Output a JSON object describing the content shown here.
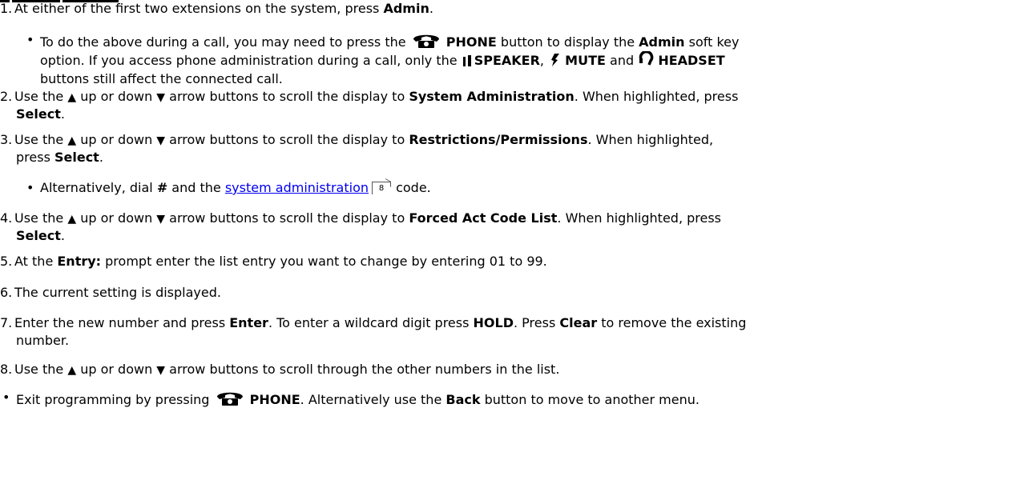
{
  "steps": {
    "s1": {
      "num": "1.",
      "a": "At either of the first two extensions on the system, press ",
      "b1": "Admin",
      "c": "."
    },
    "s1_bullet": {
      "a": "To do the above during a call, you may need to press the ",
      "b1": "PHONE",
      "c": " button to display the ",
      "b2": "Admin",
      "d": " soft key",
      "line2_a": "option. If you access phone administration during a call, only the ",
      "b3": "SPEAKER",
      "e": ", ",
      "b4": "MUTE",
      "f": " and ",
      "b5": "HEADSET",
      "line3": "buttons still affect the connected call."
    },
    "s2": {
      "num": "2.",
      "a": "Use the ",
      "up": "▲",
      "b": " up or down ",
      "down": "▼",
      "c": " arrow buttons to scroll the display to ",
      "b1": "System Administration",
      "d": ". When highlighted, press",
      "line2_b": "Select",
      "line2_c": "."
    },
    "s3": {
      "num": "3.",
      "a": "Use the ",
      "up": "▲",
      "b": " up or down ",
      "down": "▼",
      "c": " arrow buttons to scroll the display to ",
      "b1": "Restrictions/Permissions",
      "d": ". When highlighted,",
      "line2_a": "press ",
      "line2_b": "Select",
      "line2_c": "."
    },
    "s3_bullet": {
      "a": "Alternatively, dial ",
      "b1": "#",
      "c": " and the ",
      "link": "system administration",
      "ref": "8",
      "d": " code."
    },
    "s4": {
      "num": "4.",
      "a": "Use the ",
      "up": "▲",
      "b": " up or down ",
      "down": "▼",
      "c": " arrow buttons to scroll the display to ",
      "b1": "Forced Act Code List",
      "d": ". When highlighted, press",
      "line2_b": "Select",
      "line2_c": "."
    },
    "s5": {
      "num": "5.",
      "a": "At the ",
      "b1": "Entry:",
      "c": " prompt enter the list entry you want to change by entering 01 to 99."
    },
    "s6": {
      "num": "6.",
      "a": "The current setting is displayed."
    },
    "s7": {
      "num": "7.",
      "a": "Enter the new number and press ",
      "b1": "Enter",
      "c": ". To enter a wildcard digit press ",
      "b2": "HOLD",
      "d": ". Press ",
      "b3": "Clear",
      "e": " to remove the existing",
      "line2": "number."
    },
    "s8": {
      "num": "8.",
      "a": "Use the ",
      "up": "▲",
      "b": " up or down ",
      "down": "▼",
      "c": " arrow buttons to scroll through the other numbers in the list."
    },
    "final": {
      "a": "Exit programming by pressing ",
      "b1": "PHONE",
      "c": ". Alternatively use the ",
      "b2": "Back",
      "d": " button to move to another menu."
    }
  },
  "icons": {
    "phone": "phone-icon",
    "speaker": "speaker-icon",
    "mute": "mute-icon",
    "headset": "headset-icon",
    "up": "up-arrow-icon",
    "down": "down-arrow-icon"
  }
}
